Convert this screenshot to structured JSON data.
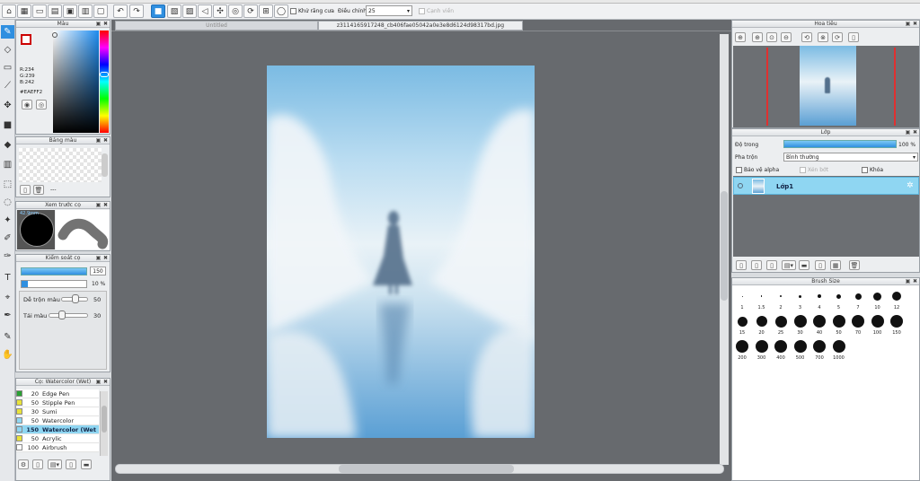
{
  "toolbar": {
    "antialias_label": "Khử răng cưa",
    "adjust_label": "Điều chỉnh",
    "adjust_value": "25",
    "edge_label": "Cạnh viền"
  },
  "tabs": {
    "untitled": "Untitled",
    "file": "z3114165917248_cb406fae05042a0e3e8d6124d98317bd.jpg"
  },
  "color_panel": {
    "title": "Màu",
    "r": "R:234",
    "g": "G:239",
    "b": "B:242",
    "hex": "#EAEFF2",
    "fg_color": "#EAEFF2"
  },
  "palette_panel": {
    "title": "Bảng màu",
    "dash": "---"
  },
  "brush_preview": {
    "title": "Xem trước cọ",
    "size_label": "42.9mm"
  },
  "brush_control": {
    "title": "Kiểm soát cọ",
    "size_value": "150",
    "opacity_value": "10 %",
    "blend_label": "Dễ trộn màu",
    "blend_value": "50",
    "refill_label": "Tải màu",
    "refill_value": "30"
  },
  "brush_list": {
    "title": "Cọ: Watercolor (Wet)",
    "items": [
      {
        "size": "20",
        "name": "Edge Pen",
        "color": "#2aa033"
      },
      {
        "size": "50",
        "name": "Stipple Pen",
        "color": "#e8e23a"
      },
      {
        "size": "30",
        "name": "Sumi",
        "color": "#e8e23a"
      },
      {
        "size": "50",
        "name": "Watercolor",
        "color": "#8fd6f2"
      },
      {
        "size": "150",
        "name": "Watercolor (Wet",
        "color": "#8fd6f2"
      },
      {
        "size": "50",
        "name": "Acrylic",
        "color": "#e8e23a"
      },
      {
        "size": "100",
        "name": "Airbrush",
        "color": "#ffffff"
      }
    ]
  },
  "navigator": {
    "title": "Hoa tiêu"
  },
  "layer_panel": {
    "title": "Lớp",
    "opacity_label": "Độ trong",
    "opacity_value": "100 %",
    "blend_label": "Pha trộn",
    "blend_value": "Bình thường",
    "protect_alpha": "Bảo vệ alpha",
    "clipping": "Xén bớt",
    "lock": "Khóa",
    "layer_name": "Lớp1"
  },
  "brush_size": {
    "title": "Brush Size",
    "sizes": [
      "1",
      "1.5",
      "2",
      "3",
      "4",
      "5",
      "7",
      "10",
      "12",
      "15",
      "20",
      "25",
      "30",
      "40",
      "50",
      "70",
      "100",
      "150",
      "200",
      "300",
      "400",
      "500",
      "700",
      "1000"
    ]
  },
  "colors": {
    "accent": "#2f8fe0",
    "selected_row": "#8fd6f2",
    "canvas_bg": "#676a6e"
  }
}
